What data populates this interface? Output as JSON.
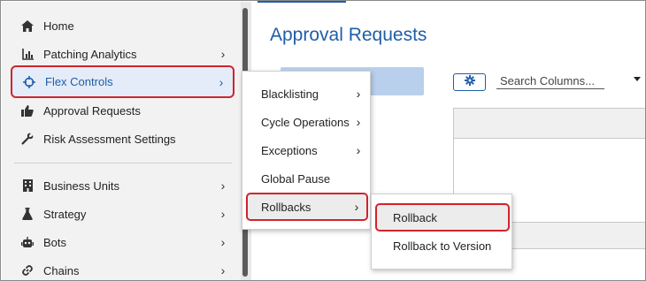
{
  "sidebar": {
    "items": [
      {
        "label": "Home",
        "icon": "home-icon",
        "has_chevron": false
      },
      {
        "label": "Patching Analytics",
        "icon": "chart-icon",
        "has_chevron": true
      },
      {
        "label": "Flex Controls",
        "icon": "crosshair-icon",
        "has_chevron": true,
        "selected": true
      },
      {
        "label": "Approval Requests",
        "icon": "thumbs-up-icon",
        "has_chevron": false
      },
      {
        "label": "Risk Assessment Settings",
        "icon": "wrench-icon",
        "has_chevron": false
      }
    ],
    "items2": [
      {
        "label": "Business Units",
        "icon": "building-icon",
        "has_chevron": true
      },
      {
        "label": "Strategy",
        "icon": "flask-icon",
        "has_chevron": true
      },
      {
        "label": "Bots",
        "icon": "robot-icon",
        "has_chevron": true
      },
      {
        "label": "Chains",
        "icon": "link-icon",
        "has_chevron": true
      }
    ]
  },
  "main": {
    "title": "Approval Requests",
    "search_placeholder": "Search Columns..."
  },
  "flex_menu": {
    "items": [
      {
        "label": "Blacklisting",
        "has_chevron": true
      },
      {
        "label": "Cycle Operations",
        "has_chevron": true
      },
      {
        "label": "Exceptions",
        "has_chevron": true
      },
      {
        "label": "Global Pause",
        "has_chevron": false
      },
      {
        "label": "Rollbacks",
        "has_chevron": true,
        "selected": true
      }
    ]
  },
  "rollbacks_menu": {
    "items": [
      {
        "label": "Rollback",
        "selected": true
      },
      {
        "label": "Rollback to Version"
      }
    ]
  },
  "colors": {
    "accent": "#1f5ea8",
    "highlight_outline": "#d0242b",
    "sidebar_bg": "#f2f2f2"
  }
}
